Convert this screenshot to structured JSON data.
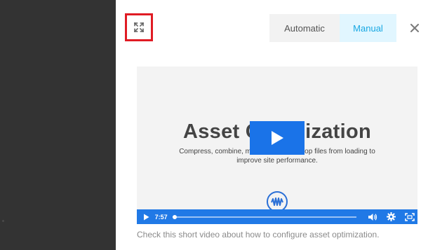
{
  "toolbar": {
    "expand_icon": "expand-arrows-icon",
    "mode_options": [
      "Automatic",
      "Manual"
    ],
    "selected_mode": "Manual",
    "close_icon": "close-icon"
  },
  "video": {
    "title": "Asset Optimization",
    "subtitle": "Compress, combine, minify and footer stop files from loading to improve site performance.",
    "time": "7:57",
    "progress": 0.01,
    "play_icon": "play-icon",
    "logo_icon": "wave-logo-icon",
    "volume_icon": "volume-icon",
    "settings_icon": "settings-gear-icon",
    "fullscreen_icon": "fullscreen-icon"
  },
  "caption": "Check this short video about how to configure asset optimization.",
  "colors": {
    "accent": "#17a8e3",
    "manual_bg": "#e1f6ff",
    "video_bar": "#2079e6",
    "highlight_border": "#e01b24"
  }
}
